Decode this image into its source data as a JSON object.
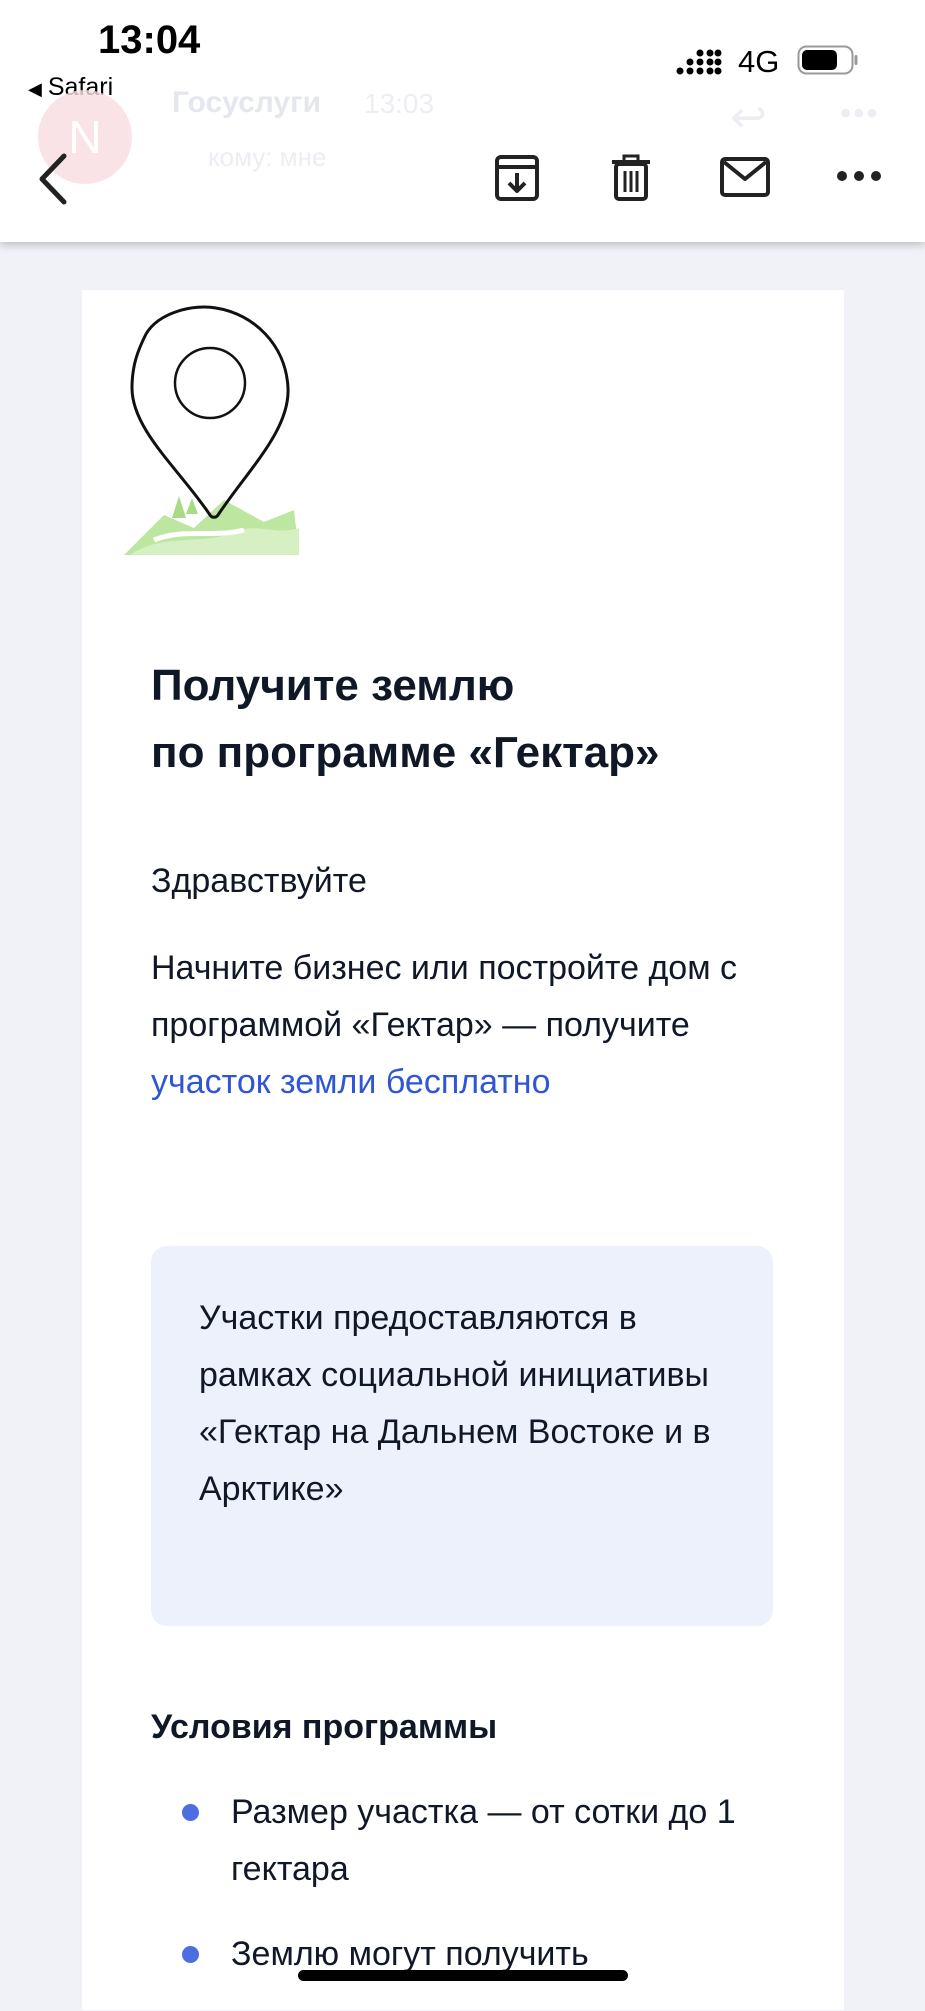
{
  "status_bar": {
    "time": "13:04",
    "back_app": "Safari",
    "network": "4G"
  },
  "mail_header": {
    "avatar_letter": "N",
    "sender": "Госуслуги",
    "time": "13:03",
    "recipient": "кому: мне"
  },
  "toolbar": {
    "icons": [
      "back-icon",
      "archive-icon",
      "trash-icon",
      "mail-icon",
      "more-icon"
    ]
  },
  "email": {
    "title_line1": "Получите землю",
    "title_line2": "по программе «Гектар»",
    "greeting": "Здравствуйте",
    "paragraph_text": "Начните бизнес или постройте дом с программой «Гектар» — получите ",
    "paragraph_link": "участок земли бесплатно",
    "notice_text": "Участки предоставляются в рамках социальной инициативы «Гектар на Дальнем Востоке и в Арктике»",
    "conditions_title": "Условия программы",
    "conditions": [
      "Размер участка — от сотки до 1 гектара",
      "Землю могут получить"
    ]
  },
  "colors": {
    "link": "#2f56d3",
    "bullet": "#4c6ee0",
    "notice_bg": "#edf1fc",
    "page_bg": "#f1f2f8",
    "hill_green": "#bde6a0"
  }
}
